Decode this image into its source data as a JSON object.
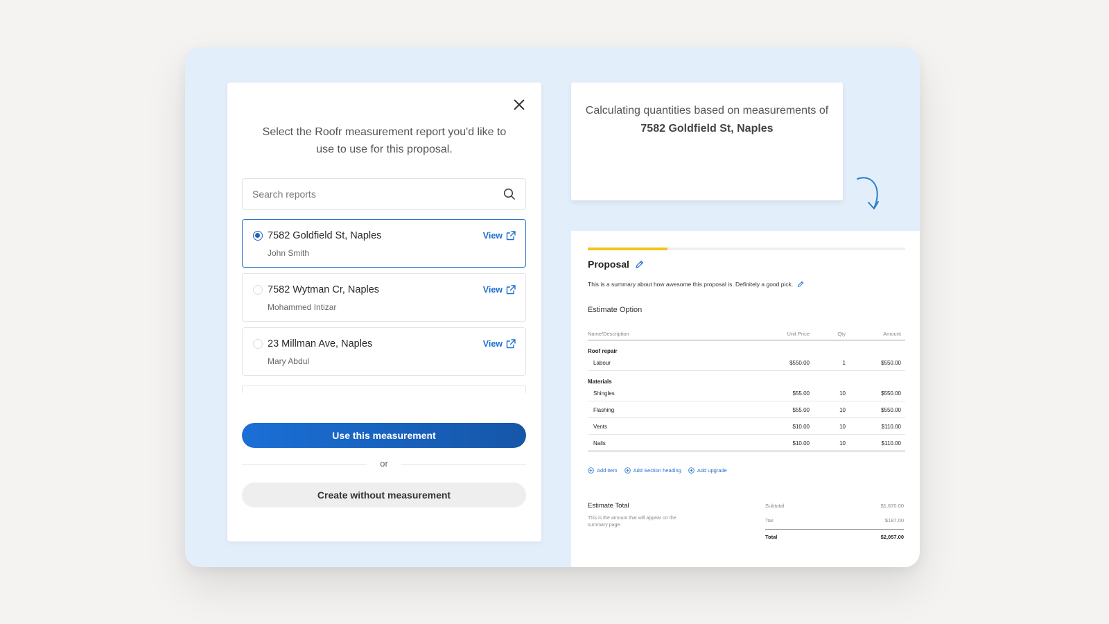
{
  "modal": {
    "title": "Select the Roofr measurement report you'd like to use to use for this proposal.",
    "search_placeholder": "Search reports",
    "reports": [
      {
        "address": "7582 Goldfield St, Naples",
        "owner": "John Smith",
        "view": "View",
        "selected": true
      },
      {
        "address": "7582 Wytman Cr, Naples",
        "owner": "Mohammed Intizar",
        "view": "View",
        "selected": false
      },
      {
        "address": "23 Millman Ave, Naples",
        "owner": "Mary Abdul",
        "view": "View",
        "selected": false
      }
    ],
    "primary_button": "Use this measurement",
    "or": "or",
    "secondary_button": "Create without measurement"
  },
  "calc_card": {
    "prefix": "Calculating quantities based on measurements of",
    "address": "7582 Goldfield St, Naples"
  },
  "proposal": {
    "progress": 0.25,
    "accent": "#f3c41a",
    "title": "Proposal",
    "summary": "This is a summary about how awesome this proposal is. Definitely a good pick.",
    "estimate_option": "Estimate Option",
    "columns": [
      "Name/Description",
      "Unit Price",
      "Qty",
      "Amount"
    ],
    "sections": [
      {
        "name": "Roof repair",
        "rows": [
          [
            "Labour",
            "$550.00",
            "1",
            "$550.00"
          ]
        ]
      },
      {
        "name": "Materials",
        "rows": [
          [
            "Shingles",
            "$55.00",
            "10",
            "$550.00"
          ],
          [
            "Flashing",
            "$55.00",
            "10",
            "$550.00"
          ],
          [
            "Vents",
            "$10.00",
            "10",
            "$110.00"
          ],
          [
            "Nails",
            "$10.00",
            "10",
            "$110.00"
          ]
        ]
      }
    ],
    "add_item": "Add item",
    "add_section": "Add Section heading",
    "add_upgrade": "Add upgrade",
    "estimate_total": "Estimate Total",
    "estimate_total_note": "This is the amount that will appear on the summary page.",
    "subtotal_label": "Subtotal",
    "subtotal": "$1,870.00",
    "tax_label": "Tax",
    "tax": "$187.00",
    "total_label": "Total",
    "total": "$2,057.00"
  }
}
